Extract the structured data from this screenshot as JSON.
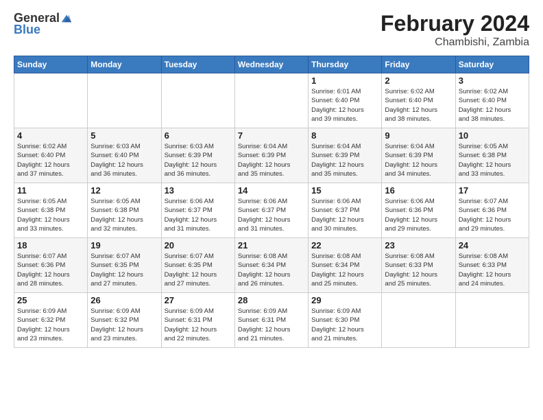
{
  "header": {
    "logo_general": "General",
    "logo_blue": "Blue",
    "main_title": "February 2024",
    "subtitle": "Chambishi, Zambia"
  },
  "weekdays": [
    "Sunday",
    "Monday",
    "Tuesday",
    "Wednesday",
    "Thursday",
    "Friday",
    "Saturday"
  ],
  "weeks": [
    [
      {
        "day": "",
        "info": ""
      },
      {
        "day": "",
        "info": ""
      },
      {
        "day": "",
        "info": ""
      },
      {
        "day": "",
        "info": ""
      },
      {
        "day": "1",
        "info": "Sunrise: 6:01 AM\nSunset: 6:40 PM\nDaylight: 12 hours\nand 39 minutes."
      },
      {
        "day": "2",
        "info": "Sunrise: 6:02 AM\nSunset: 6:40 PM\nDaylight: 12 hours\nand 38 minutes."
      },
      {
        "day": "3",
        "info": "Sunrise: 6:02 AM\nSunset: 6:40 PM\nDaylight: 12 hours\nand 38 minutes."
      }
    ],
    [
      {
        "day": "4",
        "info": "Sunrise: 6:02 AM\nSunset: 6:40 PM\nDaylight: 12 hours\nand 37 minutes."
      },
      {
        "day": "5",
        "info": "Sunrise: 6:03 AM\nSunset: 6:40 PM\nDaylight: 12 hours\nand 36 minutes."
      },
      {
        "day": "6",
        "info": "Sunrise: 6:03 AM\nSunset: 6:39 PM\nDaylight: 12 hours\nand 36 minutes."
      },
      {
        "day": "7",
        "info": "Sunrise: 6:04 AM\nSunset: 6:39 PM\nDaylight: 12 hours\nand 35 minutes."
      },
      {
        "day": "8",
        "info": "Sunrise: 6:04 AM\nSunset: 6:39 PM\nDaylight: 12 hours\nand 35 minutes."
      },
      {
        "day": "9",
        "info": "Sunrise: 6:04 AM\nSunset: 6:39 PM\nDaylight: 12 hours\nand 34 minutes."
      },
      {
        "day": "10",
        "info": "Sunrise: 6:05 AM\nSunset: 6:38 PM\nDaylight: 12 hours\nand 33 minutes."
      }
    ],
    [
      {
        "day": "11",
        "info": "Sunrise: 6:05 AM\nSunset: 6:38 PM\nDaylight: 12 hours\nand 33 minutes."
      },
      {
        "day": "12",
        "info": "Sunrise: 6:05 AM\nSunset: 6:38 PM\nDaylight: 12 hours\nand 32 minutes."
      },
      {
        "day": "13",
        "info": "Sunrise: 6:06 AM\nSunset: 6:37 PM\nDaylight: 12 hours\nand 31 minutes."
      },
      {
        "day": "14",
        "info": "Sunrise: 6:06 AM\nSunset: 6:37 PM\nDaylight: 12 hours\nand 31 minutes."
      },
      {
        "day": "15",
        "info": "Sunrise: 6:06 AM\nSunset: 6:37 PM\nDaylight: 12 hours\nand 30 minutes."
      },
      {
        "day": "16",
        "info": "Sunrise: 6:06 AM\nSunset: 6:36 PM\nDaylight: 12 hours\nand 29 minutes."
      },
      {
        "day": "17",
        "info": "Sunrise: 6:07 AM\nSunset: 6:36 PM\nDaylight: 12 hours\nand 29 minutes."
      }
    ],
    [
      {
        "day": "18",
        "info": "Sunrise: 6:07 AM\nSunset: 6:36 PM\nDaylight: 12 hours\nand 28 minutes."
      },
      {
        "day": "19",
        "info": "Sunrise: 6:07 AM\nSunset: 6:35 PM\nDaylight: 12 hours\nand 27 minutes."
      },
      {
        "day": "20",
        "info": "Sunrise: 6:07 AM\nSunset: 6:35 PM\nDaylight: 12 hours\nand 27 minutes."
      },
      {
        "day": "21",
        "info": "Sunrise: 6:08 AM\nSunset: 6:34 PM\nDaylight: 12 hours\nand 26 minutes."
      },
      {
        "day": "22",
        "info": "Sunrise: 6:08 AM\nSunset: 6:34 PM\nDaylight: 12 hours\nand 25 minutes."
      },
      {
        "day": "23",
        "info": "Sunrise: 6:08 AM\nSunset: 6:33 PM\nDaylight: 12 hours\nand 25 minutes."
      },
      {
        "day": "24",
        "info": "Sunrise: 6:08 AM\nSunset: 6:33 PM\nDaylight: 12 hours\nand 24 minutes."
      }
    ],
    [
      {
        "day": "25",
        "info": "Sunrise: 6:09 AM\nSunset: 6:32 PM\nDaylight: 12 hours\nand 23 minutes."
      },
      {
        "day": "26",
        "info": "Sunrise: 6:09 AM\nSunset: 6:32 PM\nDaylight: 12 hours\nand 23 minutes."
      },
      {
        "day": "27",
        "info": "Sunrise: 6:09 AM\nSunset: 6:31 PM\nDaylight: 12 hours\nand 22 minutes."
      },
      {
        "day": "28",
        "info": "Sunrise: 6:09 AM\nSunset: 6:31 PM\nDaylight: 12 hours\nand 21 minutes."
      },
      {
        "day": "29",
        "info": "Sunrise: 6:09 AM\nSunset: 6:30 PM\nDaylight: 12 hours\nand 21 minutes."
      },
      {
        "day": "",
        "info": ""
      },
      {
        "day": "",
        "info": ""
      }
    ]
  ]
}
